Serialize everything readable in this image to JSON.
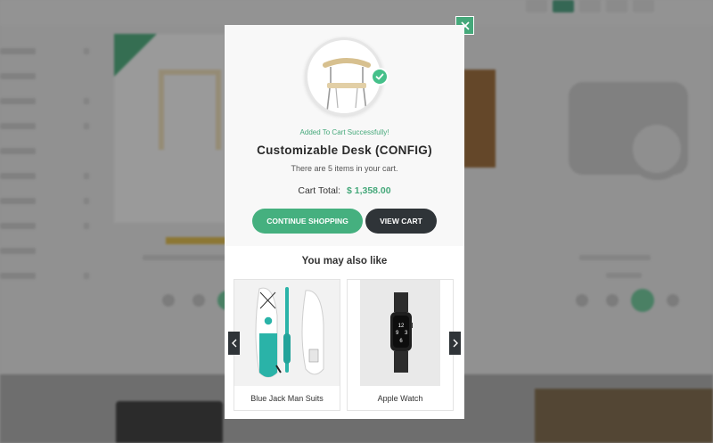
{
  "modal": {
    "added_message": "Added To Cart Successfully!",
    "product_name": "Customizable Desk (CONFIG)",
    "items_message": "There are 5 items in your cart.",
    "cart_total_label": "Cart Total:",
    "cart_total_value": "$ 1,358.00",
    "continue_label": "CONTINUE SHOPPING",
    "view_cart_label": "VIEW CART",
    "also_like_title": "You may also like",
    "close_icon": "close-icon",
    "accent_color": "#45a87a",
    "dark_color": "#2f3438"
  },
  "recommendations": [
    {
      "name": "Blue Jack Man Suits",
      "icon": "paddleboard-image"
    },
    {
      "name": "Apple Watch",
      "icon": "smartwatch-image",
      "watch_face": "12 9 6 3"
    }
  ],
  "carousel": {
    "prev_icon": "chevron-left-icon",
    "next_icon": "chevron-right-icon"
  }
}
